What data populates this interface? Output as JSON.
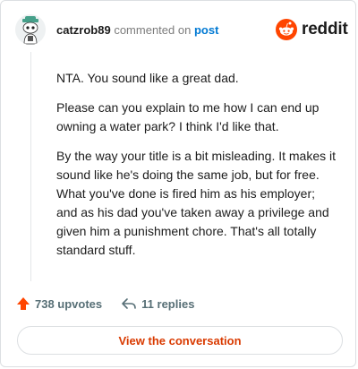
{
  "header": {
    "username": "catzrob89",
    "commented_text": "commented on",
    "post_link": "post",
    "logo_text": "reddit",
    "logo_icon": "reddit-alien-icon",
    "accent_color": "#ff4500"
  },
  "comment": {
    "paragraphs": [
      "NTA. You sound like a great dad.",
      "Please can you explain to me how I can end up owning a water park? I think I'd like that.",
      "By the way your title is a bit misleading. It makes it sound like he's doing the same job, but for free. What you've done is fired him as his employer; and as his dad you've taken away a privilege and given him a punishment chore. That's all totally standard stuff."
    ]
  },
  "actions": {
    "upvotes": "738 upvotes",
    "replies": "11 replies",
    "upvote_icon": "upvote-arrow-icon",
    "reply_icon": "reply-arrow-icon"
  },
  "footer": {
    "view_button": "View the conversation"
  }
}
